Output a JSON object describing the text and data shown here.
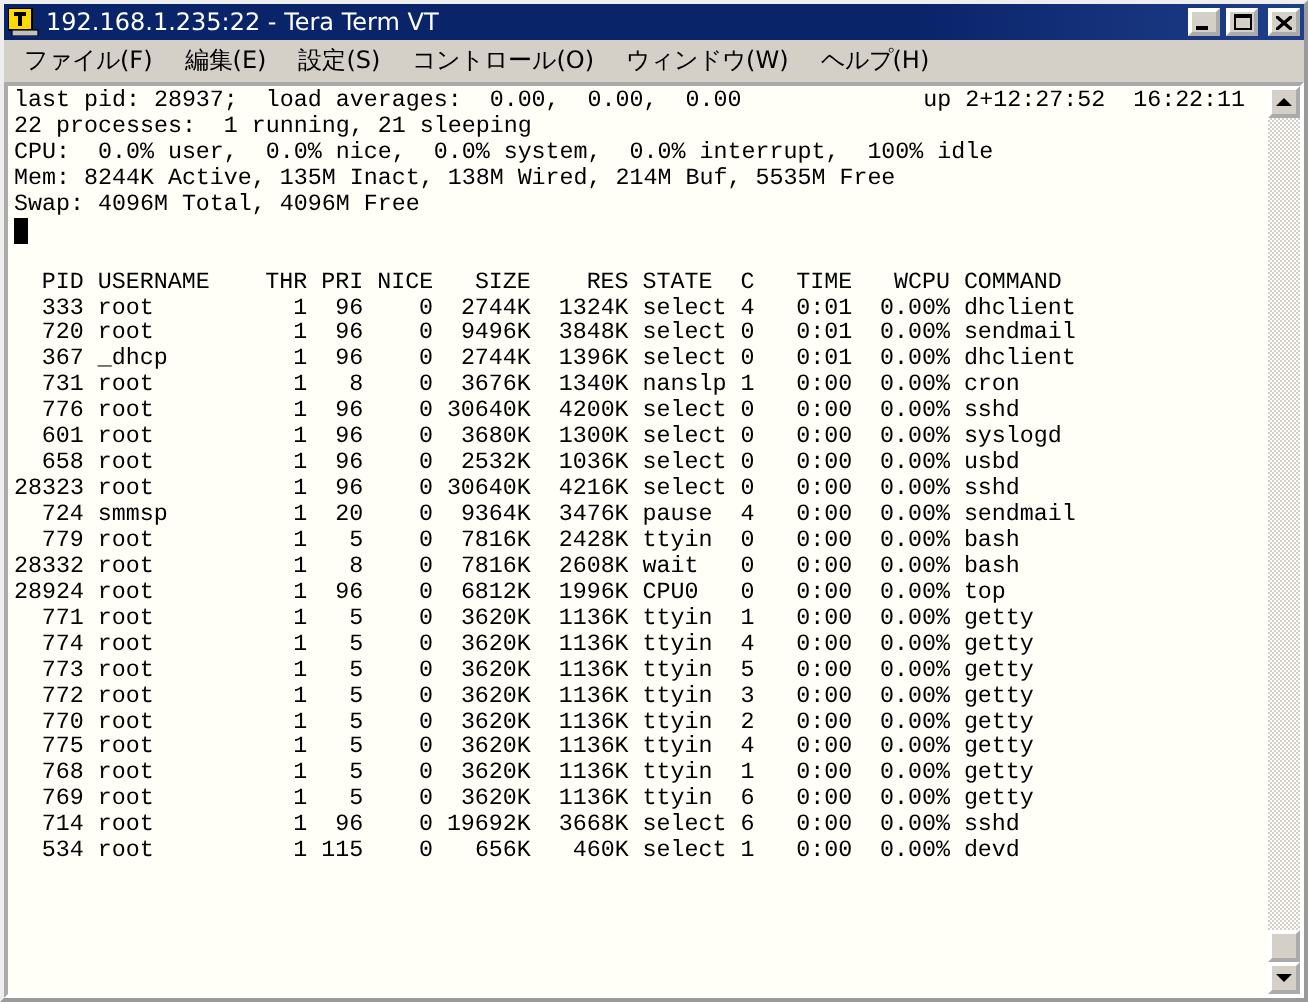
{
  "window": {
    "title": "192.168.1.235:22 - Tera Term VT"
  },
  "menu": [
    "ファイル(F)",
    "編集(E)",
    "設定(S)",
    "コントロール(O)",
    "ウィンドウ(W)",
    "ヘルプ(H)"
  ],
  "terminal": {
    "summary": {
      "left": "last pid: 28937;  load averages:  0.00,  0.00,  0.00",
      "right": "up 2+12:27:52  16:22:11"
    },
    "lines": [
      "22 processes:  1 running, 21 sleeping",
      "CPU:  0.0% user,  0.0% nice,  0.0% system,  0.0% interrupt,  100% idle",
      "Mem: 8244K Active, 135M Inact, 138M Wired, 214M Buf, 5535M Free",
      "Swap: 4096M Total, 4096M Free"
    ],
    "columns": [
      "PID",
      "USERNAME",
      "THR",
      "PRI",
      "NICE",
      "SIZE",
      "RES",
      "STATE",
      "C",
      "TIME",
      "WCPU",
      "COMMAND"
    ],
    "rows": [
      [
        "333",
        "root",
        "1",
        "96",
        "0",
        "2744K",
        "1324K",
        "select",
        "4",
        "0:01",
        "0.00%",
        "dhclient"
      ],
      [
        "720",
        "root",
        "1",
        "96",
        "0",
        "9496K",
        "3848K",
        "select",
        "0",
        "0:01",
        "0.00%",
        "sendmail"
      ],
      [
        "367",
        "_dhcp",
        "1",
        "96",
        "0",
        "2744K",
        "1396K",
        "select",
        "0",
        "0:01",
        "0.00%",
        "dhclient"
      ],
      [
        "731",
        "root",
        "1",
        "8",
        "0",
        "3676K",
        "1340K",
        "nanslp",
        "1",
        "0:00",
        "0.00%",
        "cron"
      ],
      [
        "776",
        "root",
        "1",
        "96",
        "0",
        "30640K",
        "4200K",
        "select",
        "0",
        "0:00",
        "0.00%",
        "sshd"
      ],
      [
        "601",
        "root",
        "1",
        "96",
        "0",
        "3680K",
        "1300K",
        "select",
        "0",
        "0:00",
        "0.00%",
        "syslogd"
      ],
      [
        "658",
        "root",
        "1",
        "96",
        "0",
        "2532K",
        "1036K",
        "select",
        "0",
        "0:00",
        "0.00%",
        "usbd"
      ],
      [
        "28323",
        "root",
        "1",
        "96",
        "0",
        "30640K",
        "4216K",
        "select",
        "0",
        "0:00",
        "0.00%",
        "sshd"
      ],
      [
        "724",
        "smmsp",
        "1",
        "20",
        "0",
        "9364K",
        "3476K",
        "pause",
        "4",
        "0:00",
        "0.00%",
        "sendmail"
      ],
      [
        "779",
        "root",
        "1",
        "5",
        "0",
        "7816K",
        "2428K",
        "ttyin",
        "0",
        "0:00",
        "0.00%",
        "bash"
      ],
      [
        "28332",
        "root",
        "1",
        "8",
        "0",
        "7816K",
        "2608K",
        "wait",
        "0",
        "0:00",
        "0.00%",
        "bash"
      ],
      [
        "28924",
        "root",
        "1",
        "96",
        "0",
        "6812K",
        "1996K",
        "CPU0",
        "0",
        "0:00",
        "0.00%",
        "top"
      ],
      [
        "771",
        "root",
        "1",
        "5",
        "0",
        "3620K",
        "1136K",
        "ttyin",
        "1",
        "0:00",
        "0.00%",
        "getty"
      ],
      [
        "774",
        "root",
        "1",
        "5",
        "0",
        "3620K",
        "1136K",
        "ttyin",
        "4",
        "0:00",
        "0.00%",
        "getty"
      ],
      [
        "773",
        "root",
        "1",
        "5",
        "0",
        "3620K",
        "1136K",
        "ttyin",
        "5",
        "0:00",
        "0.00%",
        "getty"
      ],
      [
        "772",
        "root",
        "1",
        "5",
        "0",
        "3620K",
        "1136K",
        "ttyin",
        "3",
        "0:00",
        "0.00%",
        "getty"
      ],
      [
        "770",
        "root",
        "1",
        "5",
        "0",
        "3620K",
        "1136K",
        "ttyin",
        "2",
        "0:00",
        "0.00%",
        "getty"
      ],
      [
        "775",
        "root",
        "1",
        "5",
        "0",
        "3620K",
        "1136K",
        "ttyin",
        "4",
        "0:00",
        "0.00%",
        "getty"
      ],
      [
        "768",
        "root",
        "1",
        "5",
        "0",
        "3620K",
        "1136K",
        "ttyin",
        "1",
        "0:00",
        "0.00%",
        "getty"
      ],
      [
        "769",
        "root",
        "1",
        "5",
        "0",
        "3620K",
        "1136K",
        "ttyin",
        "6",
        "0:00",
        "0.00%",
        "getty"
      ],
      [
        "714",
        "root",
        "1",
        "96",
        "0",
        "19692K",
        "3668K",
        "select",
        "6",
        "0:00",
        "0.00%",
        "sshd"
      ],
      [
        "534",
        "root",
        "1",
        "115",
        "0",
        "656K",
        "460K",
        "select",
        "1",
        "0:00",
        "0.00%",
        "devd"
      ]
    ]
  }
}
